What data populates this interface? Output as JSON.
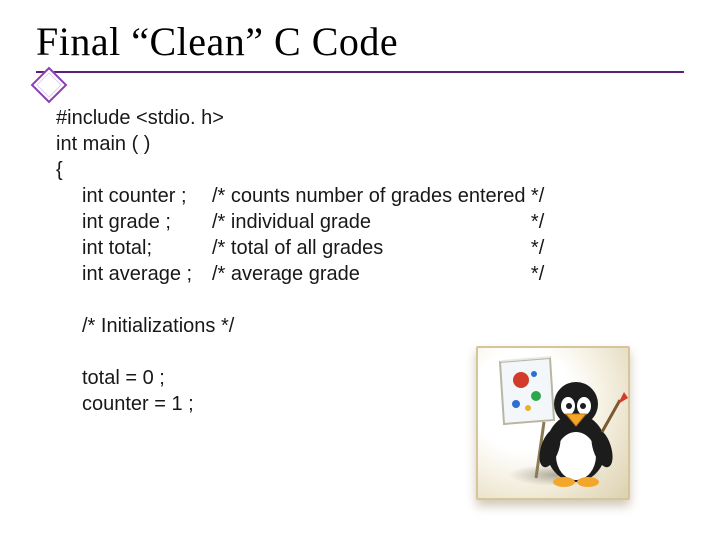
{
  "title": "Final “Clean” C Code",
  "code": {
    "line0": "#include <stdio. h>",
    "line1": "int main ( )",
    "line2": "{",
    "decl0": "int counter ;",
    "cm0_open": "/* ",
    "cm0_text": "counts number of grades entered",
    "cm0_close": " */",
    "decl1": "int grade ;",
    "cm1_open": "/* ",
    "cm1_text": "individual grade",
    "cm1_close": "*/",
    "decl2": "int total;",
    "cm2_open": "/* ",
    "cm2_text": "total of all grades",
    "cm2_close": "*/",
    "decl3": "int average ;",
    "cm3_open": "/* ",
    "cm3_text": "average grade",
    "cm3_close": "*/",
    "section_comment": "/* Initializations */",
    "init0": "total = 0 ;",
    "init1": "counter = 1 ;"
  },
  "illustration_name": "penguin-painting-icon"
}
